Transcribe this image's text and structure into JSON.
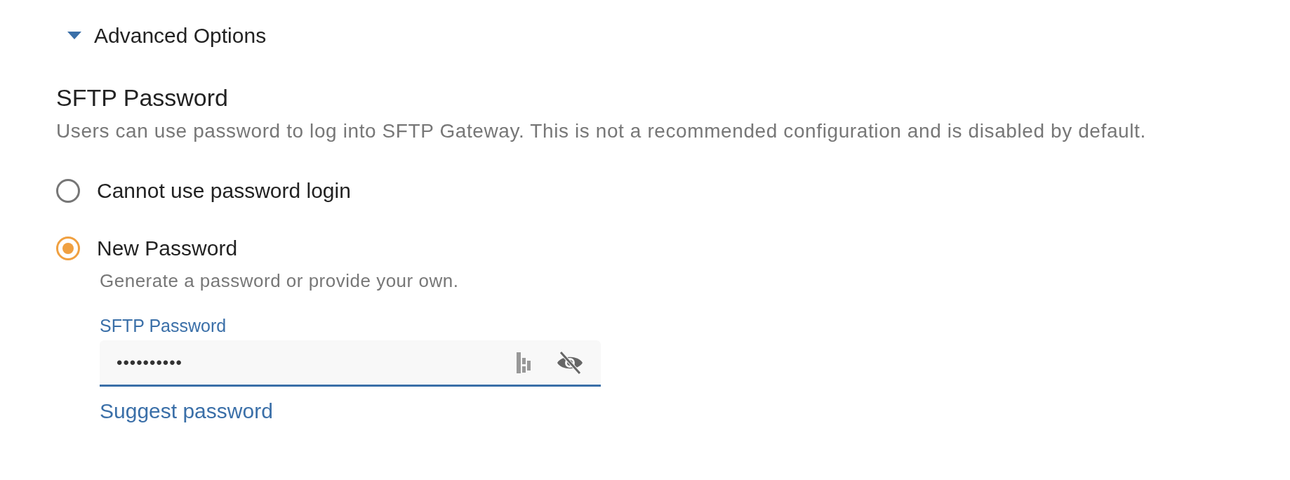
{
  "section": {
    "title": "Advanced Options",
    "expanded": true
  },
  "setting": {
    "title": "SFTP Password",
    "description": "Users can use password to log into SFTP Gateway. This is not a recommended configuration and is disabled by default."
  },
  "options": [
    {
      "label": "Cannot use password login",
      "selected": false
    },
    {
      "label": "New Password",
      "selected": true,
      "description": "Generate a password or provide your own."
    }
  ],
  "password_field": {
    "label": "SFTP Password",
    "value": "••••••••••"
  },
  "link": "Suggest password"
}
